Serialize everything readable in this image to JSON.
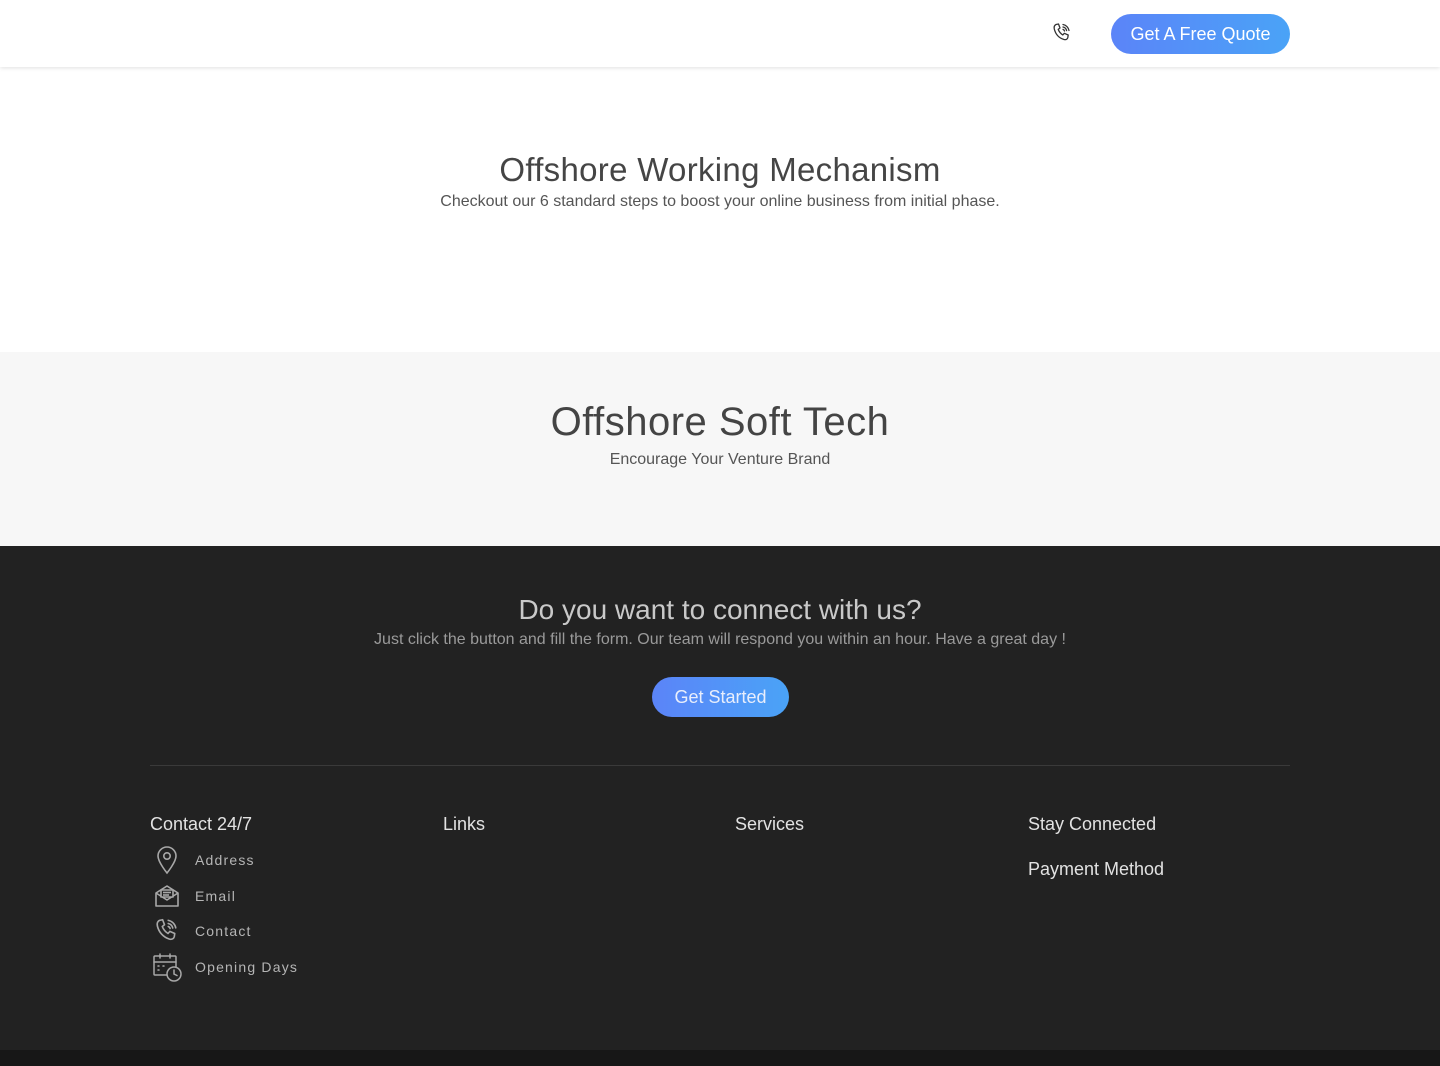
{
  "header": {
    "phone_icon": "phone-call-icon",
    "quote_button": "Get A Free Quote",
    "accent_gradient": [
      "#5b84f8",
      "#4aa3f7"
    ]
  },
  "mechanism": {
    "title": "Offshore Working Mechanism",
    "subtitle": "Checkout our 6 standard steps to boost your online business from initial phase."
  },
  "brand": {
    "title": "Offshore Soft Tech",
    "subtitle": "Encourage Your Venture Brand"
  },
  "cta": {
    "title": "Do you want to connect with us?",
    "subtitle": "Just click the button and fill the form. Our team will respond you within an hour. Have a great day !",
    "button": "Get Started"
  },
  "footer": {
    "background": "#222222",
    "columns": {
      "contact": "Contact 24/7",
      "links": "Links",
      "services": "Services",
      "stay_connected": "Stay Connected",
      "payment": "Payment Method"
    },
    "contact_items": [
      {
        "label": "Address",
        "icon": "location-pin-icon"
      },
      {
        "label": "Email",
        "icon": "email-icon"
      },
      {
        "label": "Contact",
        "icon": "phone-call-icon"
      },
      {
        "label": "Opening Days",
        "icon": "calendar-clock-icon"
      }
    ]
  }
}
